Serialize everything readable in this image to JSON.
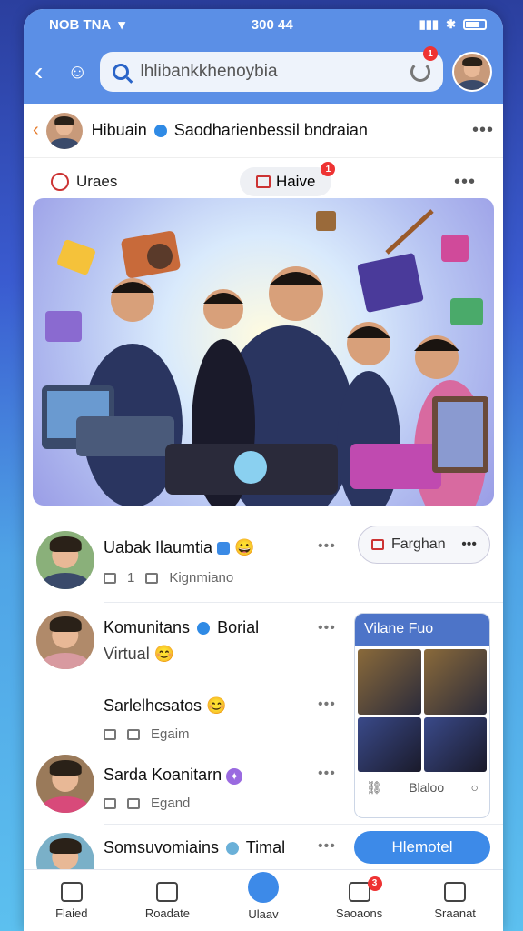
{
  "status": {
    "left": "NOB TNA",
    "center": "300 44"
  },
  "search": {
    "value": "lhlibankkhenoybia",
    "badge": "1"
  },
  "post": {
    "title": "Hibuain",
    "subtitle": "Saodharienbessil bndraian"
  },
  "actions": {
    "views_label": "Uraes",
    "live_label": "Haive",
    "live_badge": "1"
  },
  "people": [
    {
      "name": "Uabak Ilaumtia",
      "meta_count": "1",
      "meta_text": "Kignmiano"
    },
    {
      "name": "Komunitans",
      "name2": "Borial",
      "line2": "Virtual"
    },
    {
      "name": "Sarlelhcsatos",
      "meta_text": "Egaim"
    },
    {
      "name": "Sarda Koanitarn",
      "meta_text": "Egand"
    },
    {
      "name": "Somsuvomiains",
      "name2": "Timal"
    }
  ],
  "follow": {
    "label": "Farghan"
  },
  "card": {
    "title": "Vilane Fuo",
    "footer": "Blaloo"
  },
  "main_button": {
    "label": "Hlemotel"
  },
  "nav": [
    {
      "label": "Flaied"
    },
    {
      "label": "Roadate"
    },
    {
      "label": "Ulaav"
    },
    {
      "label": "Saoaons",
      "badge": "3"
    },
    {
      "label": "Sraanat"
    }
  ],
  "colors": {
    "accent": "#3d8ae8",
    "header": "#5b8fe6",
    "badge": "#e33333"
  }
}
